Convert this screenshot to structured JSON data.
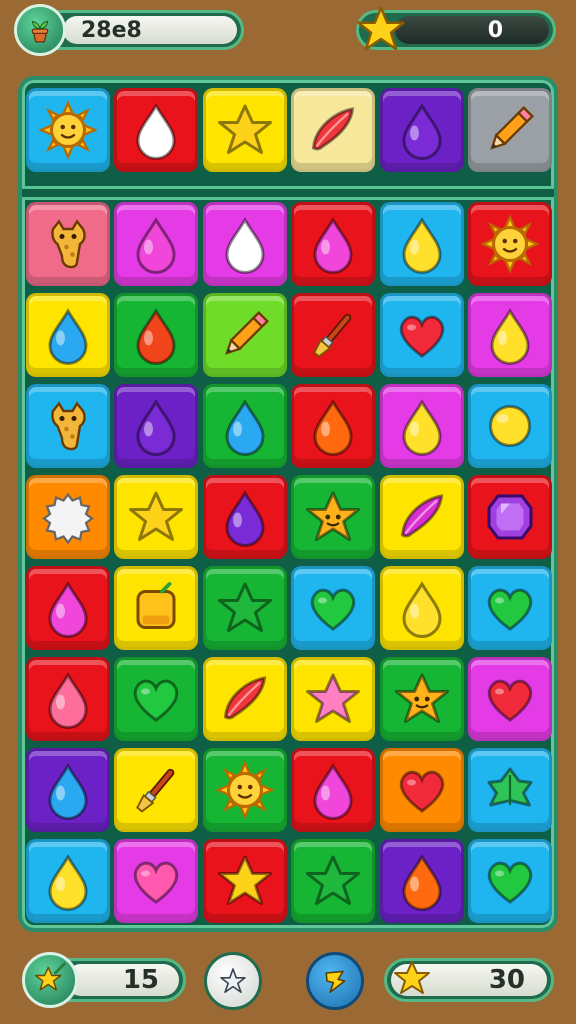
{
  "hud": {
    "coins": "28e8",
    "stars": "0"
  },
  "footer": {
    "moves": "15",
    "target": "30"
  },
  "colors": {
    "blue": "#1fb5ee",
    "red": "#e8131b",
    "yellow": "#ffe400",
    "cream": "#f6e79a",
    "purple": "#6b21c5",
    "grey": "#9aa0a6",
    "pink": "#f06b8a",
    "magenta": "#e53be6",
    "green": "#16b534",
    "lime": "#6fdc2a",
    "orange": "#ff8a00"
  },
  "board": {
    "top_row": [
      {
        "color": "blue",
        "icon": "sun"
      },
      {
        "color": "red",
        "icon": "drop-white"
      },
      {
        "color": "yellow",
        "icon": "star-yellow"
      },
      {
        "color": "cream",
        "icon": "leaf-red"
      },
      {
        "color": "purple",
        "icon": "drop-purple"
      },
      {
        "color": "grey",
        "icon": "pencil"
      }
    ],
    "rows": [
      [
        {
          "color": "pink",
          "icon": "giraffe"
        },
        {
          "color": "magenta",
          "icon": "drop-magenta"
        },
        {
          "color": "magenta",
          "icon": "drop-white"
        },
        {
          "color": "red",
          "icon": "drop-magenta"
        },
        {
          "color": "blue",
          "icon": "drop-yellow"
        },
        {
          "color": "red",
          "icon": "sun"
        }
      ],
      [
        {
          "color": "yellow",
          "icon": "drop-blue"
        },
        {
          "color": "green",
          "icon": "drop-red"
        },
        {
          "color": "lime",
          "icon": "pencil"
        },
        {
          "color": "red",
          "icon": "brush"
        },
        {
          "color": "blue",
          "icon": "heart-red"
        },
        {
          "color": "magenta",
          "icon": "drop-yellow"
        }
      ],
      [
        {
          "color": "blue",
          "icon": "giraffe"
        },
        {
          "color": "purple",
          "icon": "drop-purple"
        },
        {
          "color": "green",
          "icon": "drop-blue"
        },
        {
          "color": "red",
          "icon": "drop-orange"
        },
        {
          "color": "magenta",
          "icon": "drop-yellow"
        },
        {
          "color": "blue",
          "icon": "circle-yellow"
        }
      ],
      [
        {
          "color": "orange",
          "icon": "cloud"
        },
        {
          "color": "yellow",
          "icon": "star-yellow"
        },
        {
          "color": "red",
          "icon": "drop-purple"
        },
        {
          "color": "green",
          "icon": "star-smile"
        },
        {
          "color": "yellow",
          "icon": "leaf-magenta"
        },
        {
          "color": "red",
          "icon": "gem"
        }
      ],
      [
        {
          "color": "red",
          "icon": "drop-magenta"
        },
        {
          "color": "yellow",
          "icon": "toast"
        },
        {
          "color": "green",
          "icon": "star-green"
        },
        {
          "color": "blue",
          "icon": "heart-green"
        },
        {
          "color": "yellow",
          "icon": "drop-yellow"
        },
        {
          "color": "blue",
          "icon": "heart-green"
        }
      ],
      [
        {
          "color": "red",
          "icon": "drop-pink"
        },
        {
          "color": "green",
          "icon": "heart-green"
        },
        {
          "color": "yellow",
          "icon": "leaf-red"
        },
        {
          "color": "yellow",
          "icon": "star-pink"
        },
        {
          "color": "green",
          "icon": "star-smile"
        },
        {
          "color": "magenta",
          "icon": "heart-red"
        }
      ],
      [
        {
          "color": "purple",
          "icon": "drop-blue"
        },
        {
          "color": "yellow",
          "icon": "brush"
        },
        {
          "color": "green",
          "icon": "sun"
        },
        {
          "color": "red",
          "icon": "drop-magenta"
        },
        {
          "color": "orange",
          "icon": "heart-red"
        },
        {
          "color": "blue",
          "icon": "leaf-green"
        }
      ],
      [
        {
          "color": "blue",
          "icon": "drop-yellow"
        },
        {
          "color": "magenta",
          "icon": "heart-pink"
        },
        {
          "color": "red",
          "icon": "star-yellow"
        },
        {
          "color": "green",
          "icon": "star-green"
        },
        {
          "color": "purple",
          "icon": "drop-orange"
        },
        {
          "color": "blue",
          "icon": "heart-green"
        }
      ]
    ]
  }
}
